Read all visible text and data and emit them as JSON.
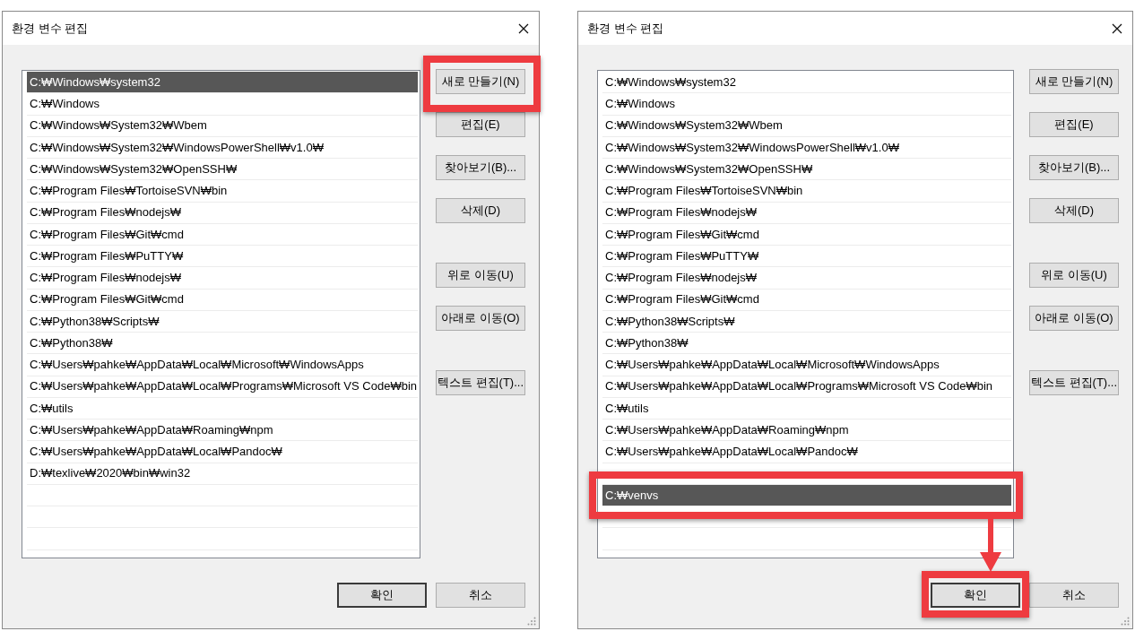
{
  "dialogs": [
    {
      "title": "환경 변수 편집",
      "list": [
        {
          "kind": "path",
          "text": "C:₩Windows₩system32",
          "selected": true,
          "highlighted": false
        },
        {
          "kind": "path",
          "text": "C:₩Windows",
          "selected": false,
          "highlighted": false
        },
        {
          "kind": "path",
          "text": "C:₩Windows₩System32₩Wbem",
          "selected": false,
          "highlighted": false
        },
        {
          "kind": "path",
          "text": "C:₩Windows₩System32₩WindowsPowerShell₩v1.0₩",
          "selected": false,
          "highlighted": false
        },
        {
          "kind": "path",
          "text": "C:₩Windows₩System32₩OpenSSH₩",
          "selected": false,
          "highlighted": false
        },
        {
          "kind": "path",
          "text": "C:₩Program Files₩TortoiseSVN₩bin",
          "selected": false,
          "highlighted": false
        },
        {
          "kind": "path",
          "text": "C:₩Program Files₩nodejs₩",
          "selected": false,
          "highlighted": false
        },
        {
          "kind": "path",
          "text": "C:₩Program Files₩Git₩cmd",
          "selected": false,
          "highlighted": false
        },
        {
          "kind": "path",
          "text": "C:₩Program Files₩PuTTY₩",
          "selected": false,
          "highlighted": false
        },
        {
          "kind": "path",
          "text": "C:₩Program Files₩nodejs₩",
          "selected": false,
          "highlighted": false
        },
        {
          "kind": "path",
          "text": "C:₩Program Files₩Git₩cmd",
          "selected": false,
          "highlighted": false
        },
        {
          "kind": "path",
          "text": "C:₩Python38₩Scripts₩",
          "selected": false,
          "highlighted": false
        },
        {
          "kind": "path",
          "text": "C:₩Python38₩",
          "selected": false,
          "highlighted": false
        },
        {
          "kind": "path",
          "text": "C:₩Users₩pahke₩AppData₩Local₩Microsoft₩WindowsApps",
          "selected": false,
          "highlighted": false
        },
        {
          "kind": "path",
          "text": "C:₩Users₩pahke₩AppData₩Local₩Programs₩Microsoft VS Code₩bin",
          "selected": false,
          "highlighted": false
        },
        {
          "kind": "path",
          "text": "C:₩utils",
          "selected": false,
          "highlighted": false
        },
        {
          "kind": "path",
          "text": "C:₩Users₩pahke₩AppData₩Roaming₩npm",
          "selected": false,
          "highlighted": false
        },
        {
          "kind": "path",
          "text": "C:₩Users₩pahke₩AppData₩Local₩Pandoc₩",
          "selected": false,
          "highlighted": false
        },
        {
          "kind": "path",
          "text": "D:₩texlive₩2020₩bin₩win32",
          "selected": false,
          "highlighted": false
        }
      ],
      "side_buttons": [
        [
          {
            "label": "새로 만들기(N)",
            "highlighted": true
          },
          {
            "label": "편집(E)",
            "highlighted": false
          },
          {
            "label": "찾아보기(B)...",
            "highlighted": false
          },
          {
            "label": "삭제(D)",
            "highlighted": false
          }
        ],
        [
          {
            "label": "위로 이동(U)",
            "highlighted": false
          },
          {
            "label": "아래로 이동(O)",
            "highlighted": false
          }
        ],
        [
          {
            "label": "텍스트 편집(T)...",
            "highlighted": false
          }
        ]
      ],
      "footer_buttons": [
        {
          "label": "확인",
          "default": true,
          "highlighted": false
        },
        {
          "label": "취소",
          "default": false,
          "highlighted": false
        }
      ]
    },
    {
      "title": "환경 변수 편집",
      "list": [
        {
          "kind": "path",
          "text": "C:₩Windows₩system32",
          "selected": false,
          "highlighted": false
        },
        {
          "kind": "path",
          "text": "C:₩Windows",
          "selected": false,
          "highlighted": false
        },
        {
          "kind": "path",
          "text": "C:₩Windows₩System32₩Wbem",
          "selected": false,
          "highlighted": false
        },
        {
          "kind": "path",
          "text": "C:₩Windows₩System32₩WindowsPowerShell₩v1.0₩",
          "selected": false,
          "highlighted": false
        },
        {
          "kind": "path",
          "text": "C:₩Windows₩System32₩OpenSSH₩",
          "selected": false,
          "highlighted": false
        },
        {
          "kind": "path",
          "text": "C:₩Program Files₩TortoiseSVN₩bin",
          "selected": false,
          "highlighted": false
        },
        {
          "kind": "path",
          "text": "C:₩Program Files₩nodejs₩",
          "selected": false,
          "highlighted": false
        },
        {
          "kind": "path",
          "text": "C:₩Program Files₩Git₩cmd",
          "selected": false,
          "highlighted": false
        },
        {
          "kind": "path",
          "text": "C:₩Program Files₩PuTTY₩",
          "selected": false,
          "highlighted": false
        },
        {
          "kind": "path",
          "text": "C:₩Program Files₩nodejs₩",
          "selected": false,
          "highlighted": false
        },
        {
          "kind": "path",
          "text": "C:₩Program Files₩Git₩cmd",
          "selected": false,
          "highlighted": false
        },
        {
          "kind": "path",
          "text": "C:₩Python38₩Scripts₩",
          "selected": false,
          "highlighted": false
        },
        {
          "kind": "path",
          "text": "C:₩Python38₩",
          "selected": false,
          "highlighted": false
        },
        {
          "kind": "path",
          "text": "C:₩Users₩pahke₩AppData₩Local₩Microsoft₩WindowsApps",
          "selected": false,
          "highlighted": false
        },
        {
          "kind": "path",
          "text": "C:₩Users₩pahke₩AppData₩Local₩Programs₩Microsoft VS Code₩bin",
          "selected": false,
          "highlighted": false
        },
        {
          "kind": "path",
          "text": "C:₩utils",
          "selected": false,
          "highlighted": false
        },
        {
          "kind": "path",
          "text": "C:₩Users₩pahke₩AppData₩Roaming₩npm",
          "selected": false,
          "highlighted": false
        },
        {
          "kind": "path",
          "text": "C:₩Users₩pahke₩AppData₩Local₩Pandoc₩",
          "selected": false,
          "highlighted": false
        },
        {
          "kind": "covered",
          "selected": false,
          "highlighted": false
        },
        {
          "kind": "path",
          "text": "C:₩venvs",
          "selected": true,
          "highlighted": true
        }
      ],
      "side_buttons": [
        [
          {
            "label": "새로 만들기(N)",
            "highlighted": false
          },
          {
            "label": "편집(E)",
            "highlighted": false
          },
          {
            "label": "찾아보기(B)...",
            "highlighted": false
          },
          {
            "label": "삭제(D)",
            "highlighted": false
          }
        ],
        [
          {
            "label": "위로 이동(U)",
            "highlighted": false
          },
          {
            "label": "아래로 이동(O)",
            "highlighted": false
          }
        ],
        [
          {
            "label": "텍스트 편집(T)...",
            "highlighted": false
          }
        ]
      ],
      "footer_buttons": [
        {
          "label": "확인",
          "default": true,
          "highlighted": true
        },
        {
          "label": "취소",
          "default": false,
          "highlighted": false
        }
      ],
      "arrow": true
    }
  ]
}
